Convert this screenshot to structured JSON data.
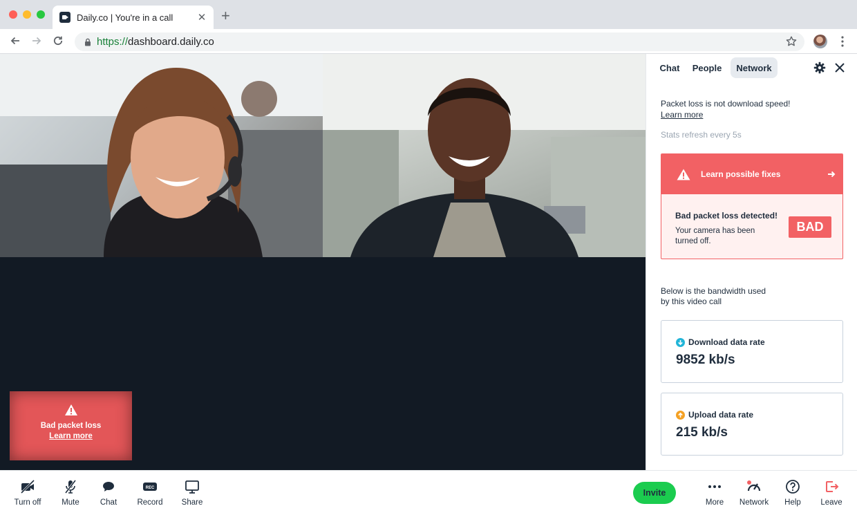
{
  "browser": {
    "tab_title": "Daily.co | You're in a call",
    "tab_close": "✕",
    "new_tab": "+",
    "url_scheme": "https://",
    "url_host": "dashboard.daily.co"
  },
  "toast": {
    "title": "Bad packet loss",
    "link": "Learn more"
  },
  "panel": {
    "tabs": {
      "chat": "Chat",
      "people": "People",
      "network": "Network"
    },
    "active_tab": "Network",
    "note": "Packet loss is not download speed!",
    "learn_more": "Learn more",
    "refresh": "Stats refresh every 5s",
    "alert": {
      "fix_label": "Learn possible fixes",
      "title": "Bad packet loss detected!",
      "body": "Your camera has been turned off.",
      "badge": "BAD"
    },
    "bandwidth_note": "Below is the bandwidth used by this video call",
    "download": {
      "label": "Download data rate",
      "value": "9852 kb/s"
    },
    "upload": {
      "label": "Upload data rate",
      "value": "215 kb/s"
    }
  },
  "tray": {
    "turn_off": "Turn off",
    "mute": "Mute",
    "chat": "Chat",
    "record": "Record",
    "share": "Share",
    "invite": "Invite",
    "more": "More",
    "network": "Network",
    "help": "Help",
    "leave": "Leave"
  },
  "colors": {
    "accent_red": "#f26164",
    "invite_green": "#1bcc4f",
    "stage_dark": "#121a24",
    "download_icon": "#22b5d8",
    "upload_icon": "#f4a124",
    "leave_red": "#f26164"
  }
}
